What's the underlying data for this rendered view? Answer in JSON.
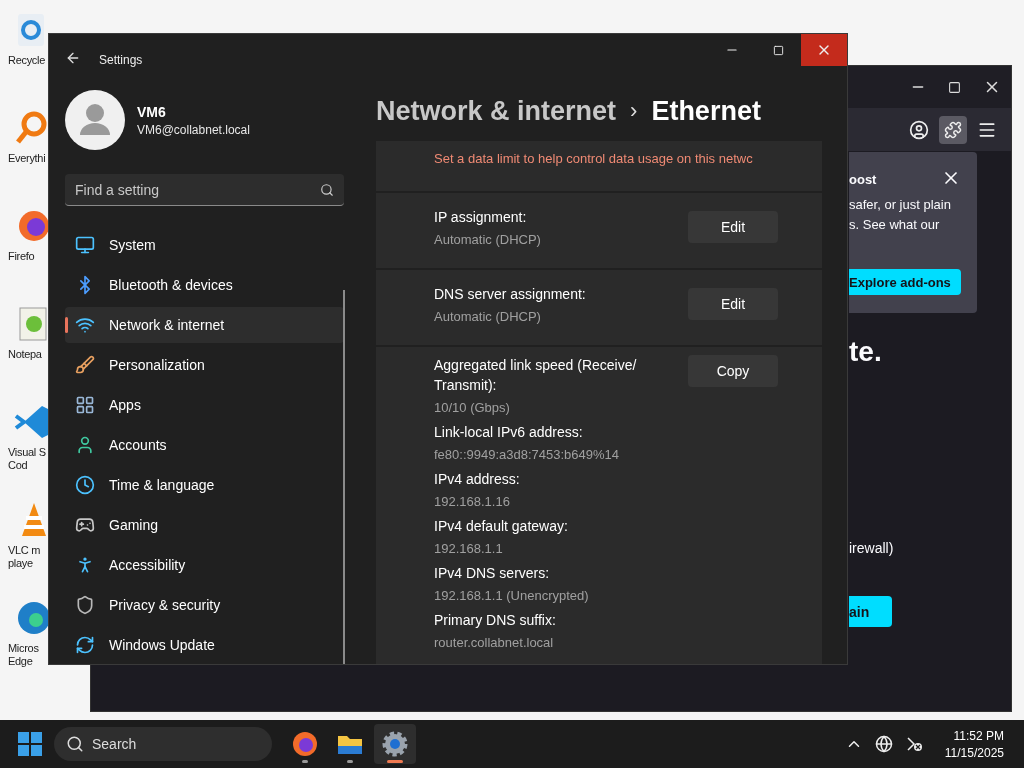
{
  "desktop_icons": [
    {
      "kind": "recycle",
      "lines": [
        "Recycle"
      ]
    },
    {
      "kind": "search",
      "lines": [
        "Everythi"
      ]
    },
    {
      "kind": "firefox",
      "lines": [
        "Firefo"
      ]
    },
    {
      "kind": "notepad",
      "lines": [
        "Notepa"
      ]
    },
    {
      "kind": "vscode",
      "lines": [
        "Visual S",
        "Cod"
      ]
    },
    {
      "kind": "vlc",
      "lines": [
        "VLC m",
        "playe"
      ]
    },
    {
      "kind": "edge",
      "lines": [
        "Micros",
        "Edge"
      ]
    }
  ],
  "browser": {
    "popup": {
      "title": "oost",
      "lines": [
        "safer, or just plain",
        "s. See what our"
      ],
      "button": "Explore add-ons"
    },
    "page": {
      "heading": "te.",
      "line": "irewall)",
      "button": "ain"
    }
  },
  "settings": {
    "title": "Settings",
    "close_highlighted": true,
    "user": {
      "name": "VM6",
      "email": "VM6@collabnet.local"
    },
    "search": {
      "placeholder": "Find a setting"
    },
    "nav": [
      {
        "kind": "system",
        "label": "System",
        "selected": false
      },
      {
        "kind": "bluetooth",
        "label": "Bluetooth & devices",
        "selected": false
      },
      {
        "kind": "network",
        "label": "Network & internet",
        "selected": true
      },
      {
        "kind": "personalization",
        "label": "Personalization",
        "selected": false
      },
      {
        "kind": "apps",
        "label": "Apps",
        "selected": false
      },
      {
        "kind": "accounts",
        "label": "Accounts",
        "selected": false
      },
      {
        "kind": "time",
        "label": "Time & language",
        "selected": false
      },
      {
        "kind": "gaming",
        "label": "Gaming",
        "selected": false
      },
      {
        "kind": "accessibility",
        "label": "Accessibility",
        "selected": false
      },
      {
        "kind": "privacy",
        "label": "Privacy & security",
        "selected": false
      },
      {
        "kind": "update",
        "label": "Windows Update",
        "selected": false
      }
    ],
    "breadcrumb": {
      "parent": "Network & internet",
      "separator": "›",
      "current": "Ethernet"
    },
    "notice": "Set a data limit to help control data usage on this netwc",
    "rows": [
      {
        "label": "IP assignment:",
        "value": "Automatic (DHCP)",
        "button": "Edit"
      },
      {
        "label": "DNS server assignment:",
        "value": "Automatic (DHCP)",
        "button": "Edit"
      }
    ],
    "details": {
      "button": "Copy",
      "items": [
        {
          "label": "Aggregated link speed (Receive/ Transmit):",
          "value": "10/10 (Gbps)"
        },
        {
          "label": "Link-local IPv6 address:",
          "value": "fe80::9949:a3d8:7453:b649%14"
        },
        {
          "label": "IPv4 address:",
          "value": "192.168.1.16"
        },
        {
          "label": "IPv4 default gateway:",
          "value": "192.168.1.1"
        },
        {
          "label": "IPv4 DNS servers:",
          "value": "192.168.1.1 (Unencrypted)"
        },
        {
          "label": "Primary DNS suffix:",
          "value": "router.collabnet.local"
        }
      ]
    }
  },
  "taskbar": {
    "search": {
      "placeholder": "Search"
    },
    "apps": [
      {
        "kind": "firefox",
        "selected": false
      },
      {
        "kind": "files",
        "selected": false
      },
      {
        "kind": "settings",
        "selected": true
      }
    ],
    "time": "11:52 PM",
    "date": "11/15/2025"
  }
}
